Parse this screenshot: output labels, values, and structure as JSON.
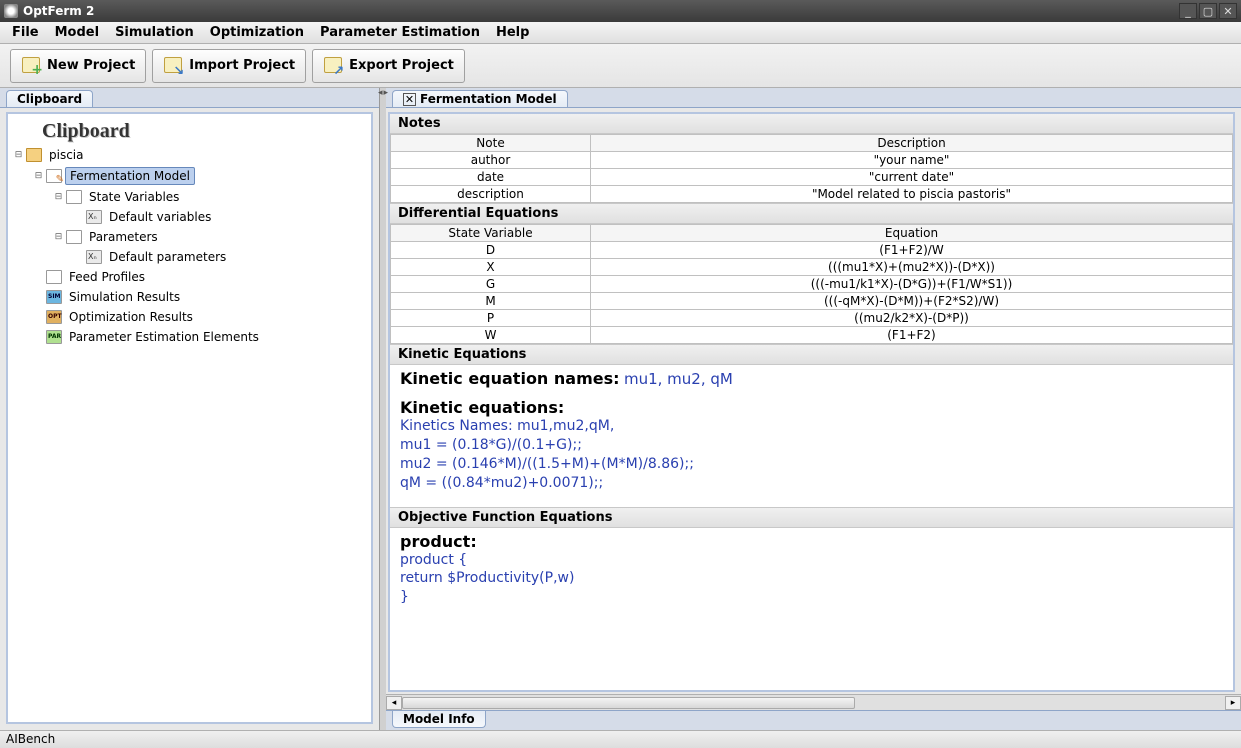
{
  "window": {
    "title": "OptFerm 2"
  },
  "menu": {
    "items": [
      "File",
      "Model",
      "Simulation",
      "Optimization",
      "Parameter Estimation",
      "Help"
    ]
  },
  "toolbar": {
    "new_project": "New Project",
    "import_project": "Import Project",
    "export_project": "Export Project"
  },
  "left_tab": "Clipboard",
  "clipboard_title": "Clipboard",
  "tree": {
    "project": "piscia",
    "nodes": {
      "fermentation_model": "Fermentation Model",
      "state_variables": "State Variables",
      "default_variables": "Default variables",
      "parameters": "Parameters",
      "default_parameters": "Default parameters",
      "feed_profiles": "Feed Profiles",
      "simulation_results": "Simulation Results",
      "optimization_results": "Optimization Results",
      "parameter_estimation_elements": "Parameter Estimation Elements"
    }
  },
  "right_tab": "Fermentation Model",
  "sections": {
    "notes": "Notes",
    "diff_eq": "Differential Equations",
    "kinetic": "Kinetic Equations",
    "objective": "Objective Function Equations"
  },
  "notes_table": {
    "headers": [
      "Note",
      "Description"
    ],
    "rows": [
      {
        "note": "author",
        "desc": "\"your name\""
      },
      {
        "note": "date",
        "desc": "\"current date\""
      },
      {
        "note": "description",
        "desc": "\"Model related to piscia pastoris\""
      }
    ]
  },
  "diff_table": {
    "headers": [
      "State Variable",
      "Equation"
    ],
    "rows": [
      {
        "var": "D",
        "eq": "(F1+F2)/W"
      },
      {
        "var": "X",
        "eq": "(((mu1*X)+(mu2*X))-(D*X))"
      },
      {
        "var": "G",
        "eq": "(((-mu1/k1*X)-(D*G))+(F1/W*S1))"
      },
      {
        "var": "M",
        "eq": "(((-qM*X)-(D*M))+(F2*S2)/W)"
      },
      {
        "var": "P",
        "eq": "((mu2/k2*X)-(D*P))"
      },
      {
        "var": "W",
        "eq": "(F1+F2)"
      }
    ]
  },
  "kinetic": {
    "names_label": "Kinetic equation names:",
    "names": "mu1, mu2, qM",
    "eq_label": "Kinetic equations:",
    "lines": [
      "Kinetics Names: mu1,mu2,qM,",
      "mu1 = (0.18*G)/(0.1+G);;",
      "mu2 = (0.146*M)/((1.5+M)+(M*M)/8.86);;",
      "qM = ((0.84*mu2)+0.0071);;"
    ]
  },
  "objective": {
    "label": "product:",
    "lines": [
      "product    {",
      "return $Productivity(P,w)",
      "}"
    ]
  },
  "bottom_tab": "Model Info",
  "status": "AIBench"
}
